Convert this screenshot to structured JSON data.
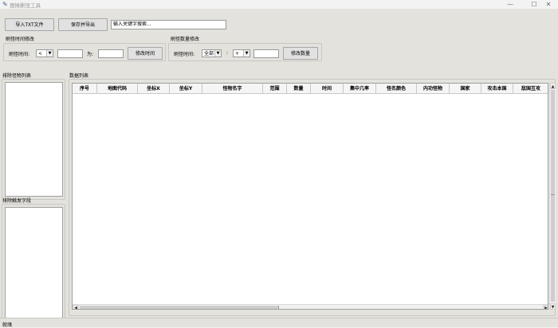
{
  "window": {
    "title": "摆摊删怪工具",
    "minimize": "—",
    "maximize": "☐",
    "close": "✕"
  },
  "toolbar": {
    "import_label": "导入TXT文件",
    "save_export_label": "保存并导出",
    "search_placeholder": "输入关键字搜索..."
  },
  "refresh_time_group": {
    "title": "刷怪时间修改",
    "label": "刷怪时间:",
    "operator": "<",
    "to_label": "为:",
    "button": "修改时间"
  },
  "refresh_count_group": {
    "title": "刷怪数量修改",
    "label": "刷怪时间:",
    "scope": "全部",
    "colon": ":",
    "operator": "+",
    "button": "修改数量"
  },
  "excluded_monsters": {
    "title": "排除怪物列表"
  },
  "excluded_triggers": {
    "title": "排除触发字段"
  },
  "data_list": {
    "title": "数据列表",
    "columns": [
      "序号",
      "地图代码",
      "坐标X",
      "坐标Y",
      "怪物名字",
      "范围",
      "数量",
      "时间",
      "集中几率",
      "怪名颜色",
      "内功怪物",
      "国家",
      "攻击本国",
      "敌国互攻"
    ]
  },
  "status": {
    "text": "就绪"
  },
  "colors": {
    "window_bg": "#e4e2dd",
    "panel_bg": "#ffffff",
    "button_bg": "#e1e1e1"
  },
  "icons": {
    "app": "feather-icon"
  }
}
